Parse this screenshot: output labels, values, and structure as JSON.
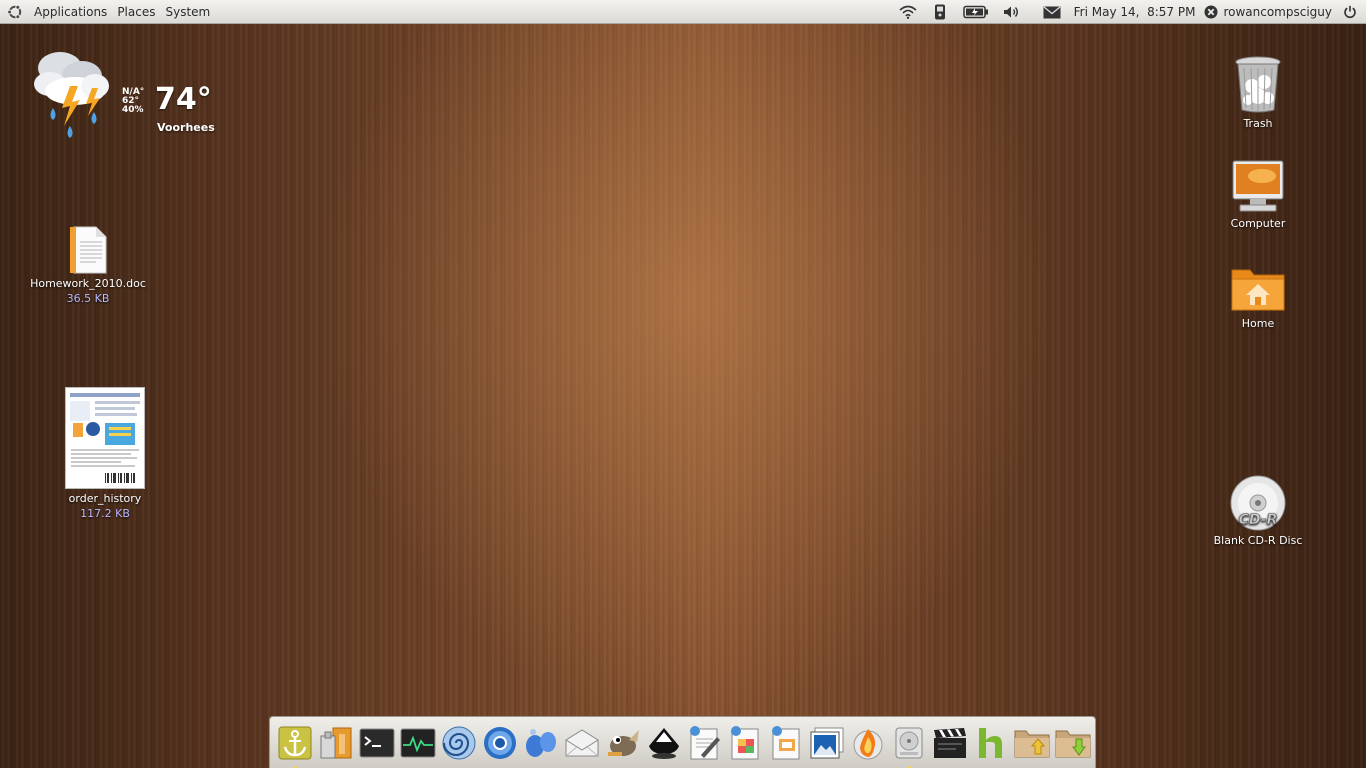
{
  "top_panel": {
    "menus": [
      "Applications",
      "Places",
      "System"
    ],
    "clock": "Fri May 14,  8:57 PM",
    "username": "rowancompsciguy",
    "tray_icons": [
      "wifi-icon",
      "phone-icon",
      "battery-icon",
      "volume-icon",
      "mail-icon"
    ]
  },
  "weather": {
    "condition_icon": "thunderstorm-icon",
    "stat1": "N/A°",
    "stat2": "62°",
    "stat3": "40%",
    "temperature": "74°",
    "city": "Voorhees"
  },
  "desktop_left": [
    {
      "label": "Homework_2010.doc",
      "size": "36.5 KB",
      "icon": "document-icon"
    },
    {
      "label": "order_history",
      "size": "117.2 KB",
      "icon": "pdf-thumbnail-icon"
    }
  ],
  "desktop_right": [
    {
      "label": "Trash",
      "icon": "trash-icon"
    },
    {
      "label": "Computer",
      "icon": "computer-icon"
    },
    {
      "label": "Home",
      "icon": "home-folder-icon"
    },
    {
      "label": "Blank CD-R Disc",
      "icon": "cd-icon",
      "disc_text": "CD-R"
    }
  ],
  "dock": {
    "items": [
      {
        "name": "anchor-icon",
        "running": true
      },
      {
        "name": "package-icon",
        "running": false
      },
      {
        "name": "terminal-icon",
        "running": false
      },
      {
        "name": "system-monitor-icon",
        "running": false
      },
      {
        "name": "nautilus-swirl-icon",
        "running": false
      },
      {
        "name": "chromium-icon",
        "running": false
      },
      {
        "name": "pidgin-icon",
        "running": false
      },
      {
        "name": "mail-client-icon",
        "running": false
      },
      {
        "name": "gimp-icon",
        "running": false
      },
      {
        "name": "inkscape-icon",
        "running": false
      },
      {
        "name": "text-editor-icon",
        "running": false
      },
      {
        "name": "spreadsheet-icon",
        "running": false
      },
      {
        "name": "presentation-icon",
        "running": false
      },
      {
        "name": "image-viewer-icon",
        "running": false
      },
      {
        "name": "burner-flame-icon",
        "running": false
      },
      {
        "name": "disk-utility-icon",
        "running": true
      },
      {
        "name": "movie-clapper-icon",
        "running": false
      },
      {
        "name": "hulu-icon",
        "running": false
      },
      {
        "name": "upload-folder-icon",
        "running": false
      },
      {
        "name": "download-folder-icon",
        "running": false
      }
    ]
  }
}
